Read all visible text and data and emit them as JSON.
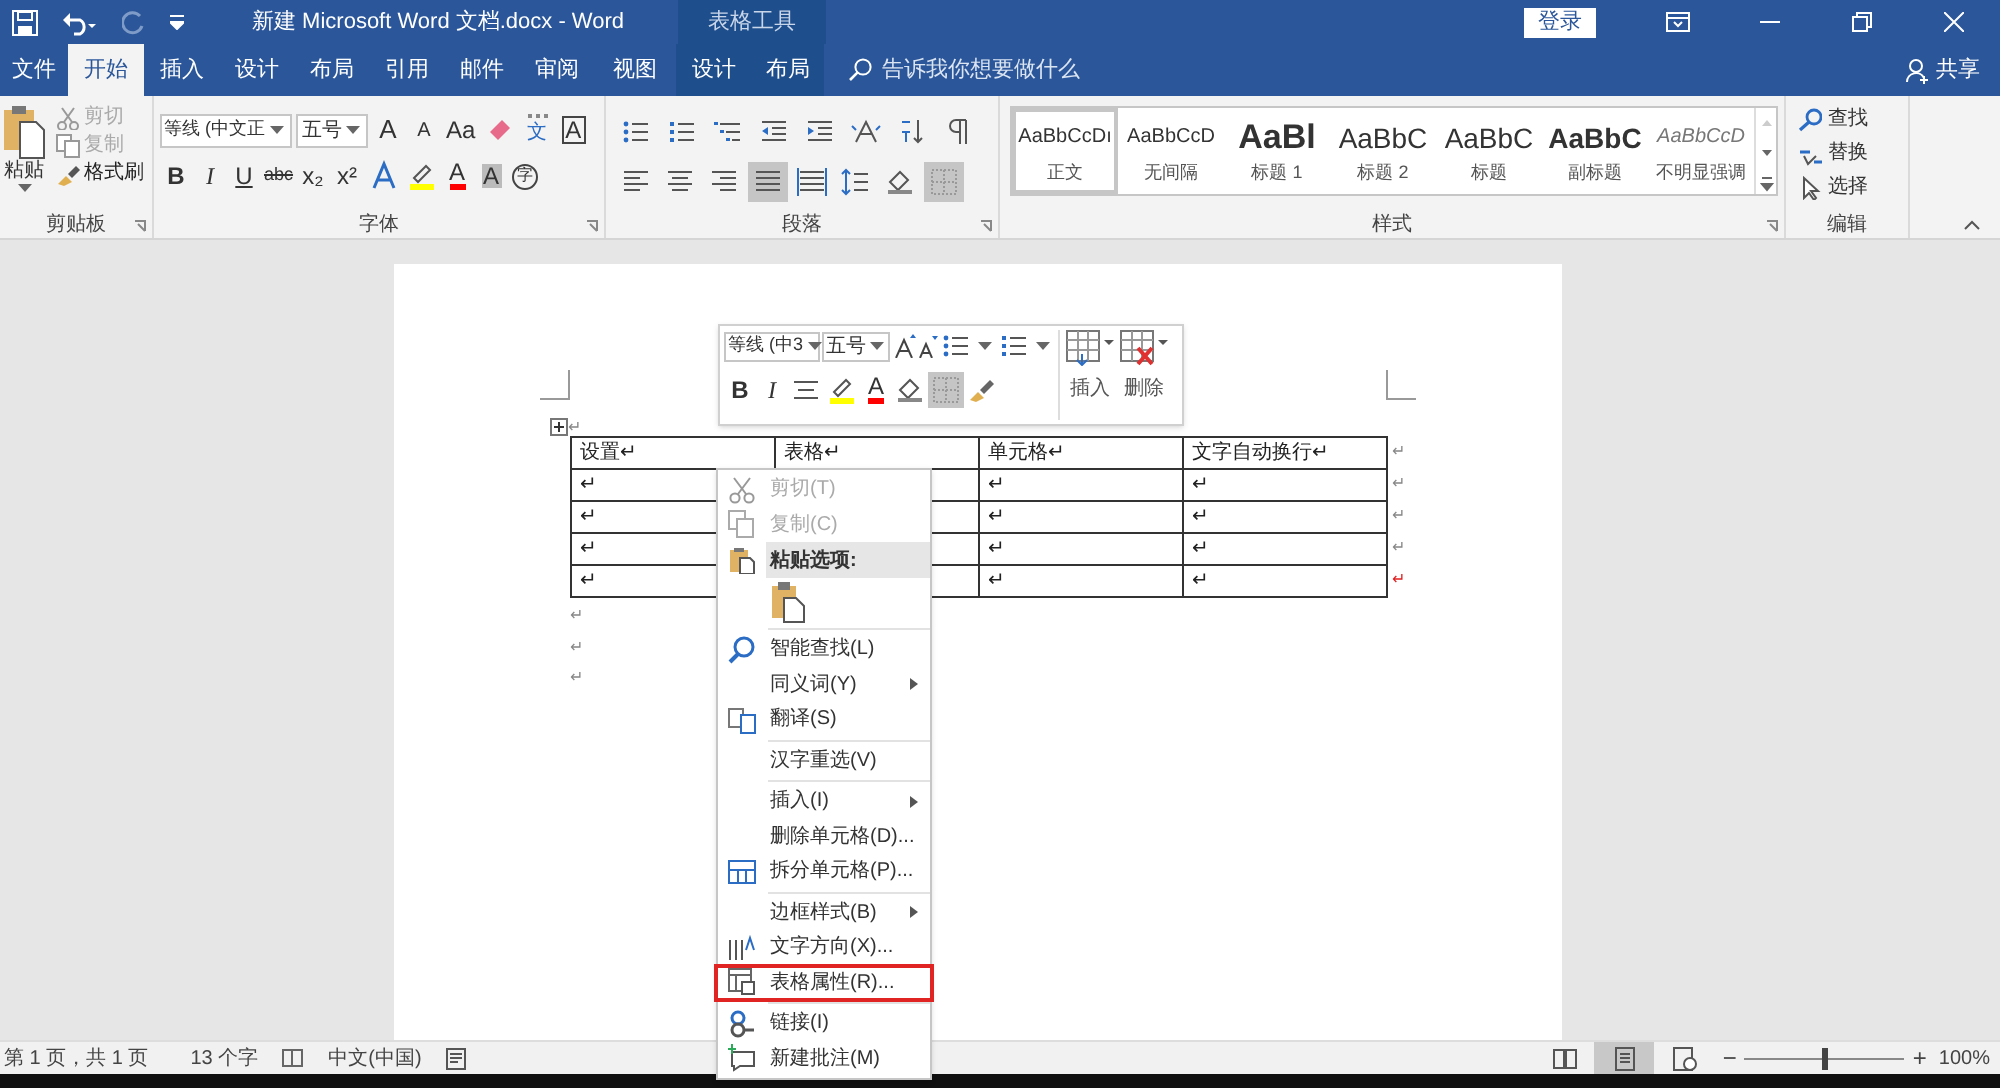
{
  "title_bar": {
    "title": "新建 Microsoft Word 文档.docx  -  Word",
    "context_group": "表格工具",
    "sign_in": "登录"
  },
  "tabs": [
    {
      "label": "文件",
      "selected": false,
      "contextual": false
    },
    {
      "label": "开始",
      "selected": true,
      "contextual": false
    },
    {
      "label": "插入",
      "selected": false,
      "contextual": false
    },
    {
      "label": "设计",
      "selected": false,
      "contextual": false
    },
    {
      "label": "布局",
      "selected": false,
      "contextual": false
    },
    {
      "label": "引用",
      "selected": false,
      "contextual": false
    },
    {
      "label": "邮件",
      "selected": false,
      "contextual": false
    },
    {
      "label": "审阅",
      "selected": false,
      "contextual": false
    },
    {
      "label": "视图",
      "selected": false,
      "contextual": false
    },
    {
      "label": "设计",
      "selected": false,
      "contextual": true
    },
    {
      "label": "布局",
      "selected": false,
      "contextual": true
    }
  ],
  "tell_me": {
    "placeholder": "告诉我你想要做什么"
  },
  "share": "共享",
  "ribbon": {
    "clipboard": {
      "title": "剪贴板",
      "paste": "粘贴",
      "items": [
        {
          "kind": "cut",
          "label": "剪切",
          "disabled": true
        },
        {
          "kind": "copy",
          "label": "复制",
          "disabled": true
        },
        {
          "kind": "painter",
          "label": "格式刷",
          "disabled": false
        }
      ]
    },
    "font": {
      "title": "字体",
      "font_name": "等线 (中文正",
      "font_size": "五号",
      "row1": [
        {
          "kind": "grow",
          "glyph": "A"
        },
        {
          "kind": "shrink",
          "glyph": "A"
        },
        {
          "kind": "case",
          "glyph": "Aa"
        },
        {
          "kind": "clear"
        },
        {
          "kind": "phonetic",
          "glyph": "文"
        },
        {
          "kind": "border",
          "glyph": "A"
        }
      ],
      "row2": [
        {
          "kind": "bold",
          "glyph": "B"
        },
        {
          "kind": "italic",
          "glyph": "I"
        },
        {
          "kind": "underline",
          "glyph": "U"
        },
        {
          "kind": "strike",
          "glyph": "abc"
        },
        {
          "kind": "sub",
          "glyph": "x₂"
        },
        {
          "kind": "sup",
          "glyph": "x²"
        },
        {
          "kind": "effects"
        },
        {
          "kind": "highlight"
        },
        {
          "kind": "color",
          "glyph": "A"
        },
        {
          "kind": "shading",
          "glyph": "A"
        },
        {
          "kind": "enclose",
          "glyph": "字"
        }
      ]
    },
    "paragraph": {
      "title": "段落",
      "row1": [
        {
          "kind": "bullets",
          "selected": false
        },
        {
          "kind": "numbering",
          "selected": false
        },
        {
          "kind": "multilevel",
          "selected": false
        },
        {
          "kind": "outdent",
          "selected": false
        },
        {
          "kind": "indent",
          "selected": false
        },
        {
          "kind": "asian",
          "selected": false
        },
        {
          "kind": "sort",
          "selected": false
        },
        {
          "kind": "marks",
          "selected": false
        }
      ],
      "row2": [
        {
          "kind": "align-left",
          "selected": false
        },
        {
          "kind": "align-center",
          "selected": false
        },
        {
          "kind": "align-right",
          "selected": false
        },
        {
          "kind": "justify",
          "selected": true
        },
        {
          "kind": "distribute",
          "selected": false
        },
        {
          "kind": "spacing",
          "selected": false
        },
        {
          "kind": "shading",
          "selected": false
        },
        {
          "kind": "borders",
          "selected": true
        }
      ]
    },
    "styles": {
      "title": "样式",
      "items": [
        {
          "kind": "normal",
          "preview": "AaBbCcDı",
          "label": "正文",
          "selected": true
        },
        {
          "kind": "normal",
          "preview": "AaBbCcD",
          "label": "无间隔",
          "selected": false
        },
        {
          "kind": "heading1",
          "preview": "AaBl",
          "label": "标题 1",
          "selected": false
        },
        {
          "kind": "heading2",
          "preview": "AaBbC",
          "label": "标题 2",
          "selected": false
        },
        {
          "kind": "title",
          "preview": "AaBbC",
          "label": "标题",
          "selected": false
        },
        {
          "kind": "subtitle",
          "preview": "AaBbC",
          "label": "副标题",
          "selected": false
        },
        {
          "kind": "subtle",
          "preview": "AaBbCcD",
          "label": "不明显强调",
          "selected": false
        }
      ]
    },
    "editing": {
      "title": "编辑",
      "items": [
        {
          "kind": "find",
          "label": "查找"
        },
        {
          "kind": "replace",
          "label": "替换"
        },
        {
          "kind": "select",
          "label": "选择"
        }
      ]
    }
  },
  "mini_toolbar": {
    "font_name": "等线 (中3",
    "font_size": "五号",
    "insert": "插入",
    "delete": "删除",
    "row2": [
      {
        "kind": "bold",
        "glyph": "B"
      },
      {
        "kind": "italic",
        "glyph": "I"
      },
      {
        "kind": "center"
      },
      {
        "kind": "highlight"
      },
      {
        "kind": "color",
        "glyph": "A"
      },
      {
        "kind": "shading"
      },
      {
        "kind": "borders",
        "selected": true
      },
      {
        "kind": "painter"
      }
    ]
  },
  "document": {
    "table": {
      "rows": [
        [
          "设置↵",
          "表格↵",
          "单元格↵",
          "文字自动换行↵"
        ],
        [
          "↵",
          null,
          "↵",
          "↵"
        ],
        [
          "↵",
          null,
          "↵",
          "↵"
        ],
        [
          "↵",
          null,
          "↵",
          "↵"
        ],
        [
          "↵",
          null,
          "↵",
          "↵"
        ]
      ],
      "row_ends": [
        "↵",
        "↵",
        "↵",
        "↵",
        "↵"
      ]
    },
    "handle_mark": "↵",
    "paragraphs": [
      "↵",
      "↵",
      "↵"
    ]
  },
  "context_menu": [
    {
      "kind": "cut",
      "label": "剪切(T)",
      "disabled": true,
      "submenu": false,
      "highlighted": false
    },
    {
      "kind": "copy",
      "label": "复制(C)",
      "disabled": true,
      "submenu": false,
      "highlighted": false
    },
    {
      "kind": "header",
      "label": "粘贴选项:"
    },
    {
      "kind": "paste_options"
    },
    {
      "kind": "separator"
    },
    {
      "kind": "lookup",
      "label": "智能查找(L)",
      "disabled": false,
      "submenu": false,
      "highlighted": false
    },
    {
      "kind": "item",
      "label": "同义词(Y)",
      "disabled": false,
      "submenu": true,
      "highlighted": false
    },
    {
      "kind": "translate",
      "label": "翻译(S)",
      "disabled": false,
      "submenu": false,
      "highlighted": false
    },
    {
      "kind": "separator"
    },
    {
      "kind": "item",
      "label": "汉字重选(V)",
      "disabled": false,
      "submenu": false,
      "highlighted": false
    },
    {
      "kind": "separator"
    },
    {
      "kind": "item",
      "label": "插入(I)",
      "disabled": false,
      "submenu": true,
      "highlighted": false
    },
    {
      "kind": "item",
      "label": "删除单元格(D)...",
      "disabled": false,
      "submenu": false,
      "highlighted": false
    },
    {
      "kind": "split",
      "label": "拆分单元格(P)...",
      "disabled": false,
      "submenu": false,
      "highlighted": false
    },
    {
      "kind": "separator"
    },
    {
      "kind": "item",
      "label": "边框样式(B)",
      "disabled": false,
      "submenu": true,
      "highlighted": false
    },
    {
      "kind": "direction",
      "label": "文字方向(X)...",
      "disabled": false,
      "submenu": false,
      "highlighted": false
    },
    {
      "kind": "properties",
      "label": "表格属性(R)...",
      "disabled": false,
      "submenu": false,
      "highlighted": true
    },
    {
      "kind": "separator"
    },
    {
      "kind": "link",
      "label": "链接(I)",
      "disabled": false,
      "submenu": false,
      "highlighted": false
    },
    {
      "kind": "comment",
      "label": "新建批注(M)",
      "disabled": false,
      "submenu": false,
      "highlighted": false
    }
  ],
  "status_bar": {
    "page": "第 1 页，共 1 页",
    "words": "13 个字",
    "language": "中文(中国)",
    "views": [
      {
        "kind": "read",
        "selected": false
      },
      {
        "kind": "print",
        "selected": true
      },
      {
        "kind": "web",
        "selected": false
      }
    ],
    "zoom": {
      "out": "−",
      "in": "+",
      "level": 0.5,
      "reading": "100%"
    }
  }
}
